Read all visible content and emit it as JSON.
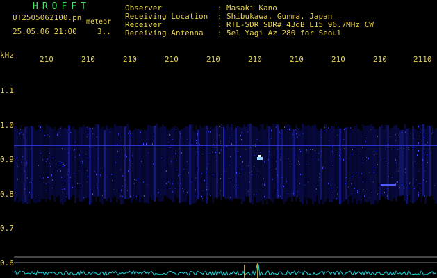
{
  "app": {
    "name": "HROFFT"
  },
  "file": {
    "name": "UT2505062100.pn",
    "label": "meteor",
    "datetime": "25.05.06 21:00",
    "count": "3.."
  },
  "header_fields": [
    {
      "key": "Observer",
      "value": "Masaki Kano"
    },
    {
      "key": "Receiving Location",
      "value": "Shibukawa, Gunma, Japan"
    },
    {
      "key": "Receiver",
      "value": "RTL-SDR SDR# 43dB L15 96.7MHz CW"
    },
    {
      "key": "Receiving Antenna",
      "value": "5el Yagi Az 280 for Seoul"
    }
  ],
  "separator": ":",
  "y_axis": {
    "unit": "kHz",
    "ticks": [
      "1.1",
      "1.0",
      "0.9",
      "0.8",
      "0.7",
      "0.6"
    ]
  },
  "x_axis": {
    "ticks": [
      "210",
      "210",
      "210",
      "210",
      "210",
      "210",
      "210",
      "210",
      "210",
      "2110"
    ]
  },
  "colors": {
    "text": "#e9d34a",
    "title": "#49e067",
    "background": "#000000",
    "signal": "#3f46ff",
    "trace": "#20d8e0"
  }
}
